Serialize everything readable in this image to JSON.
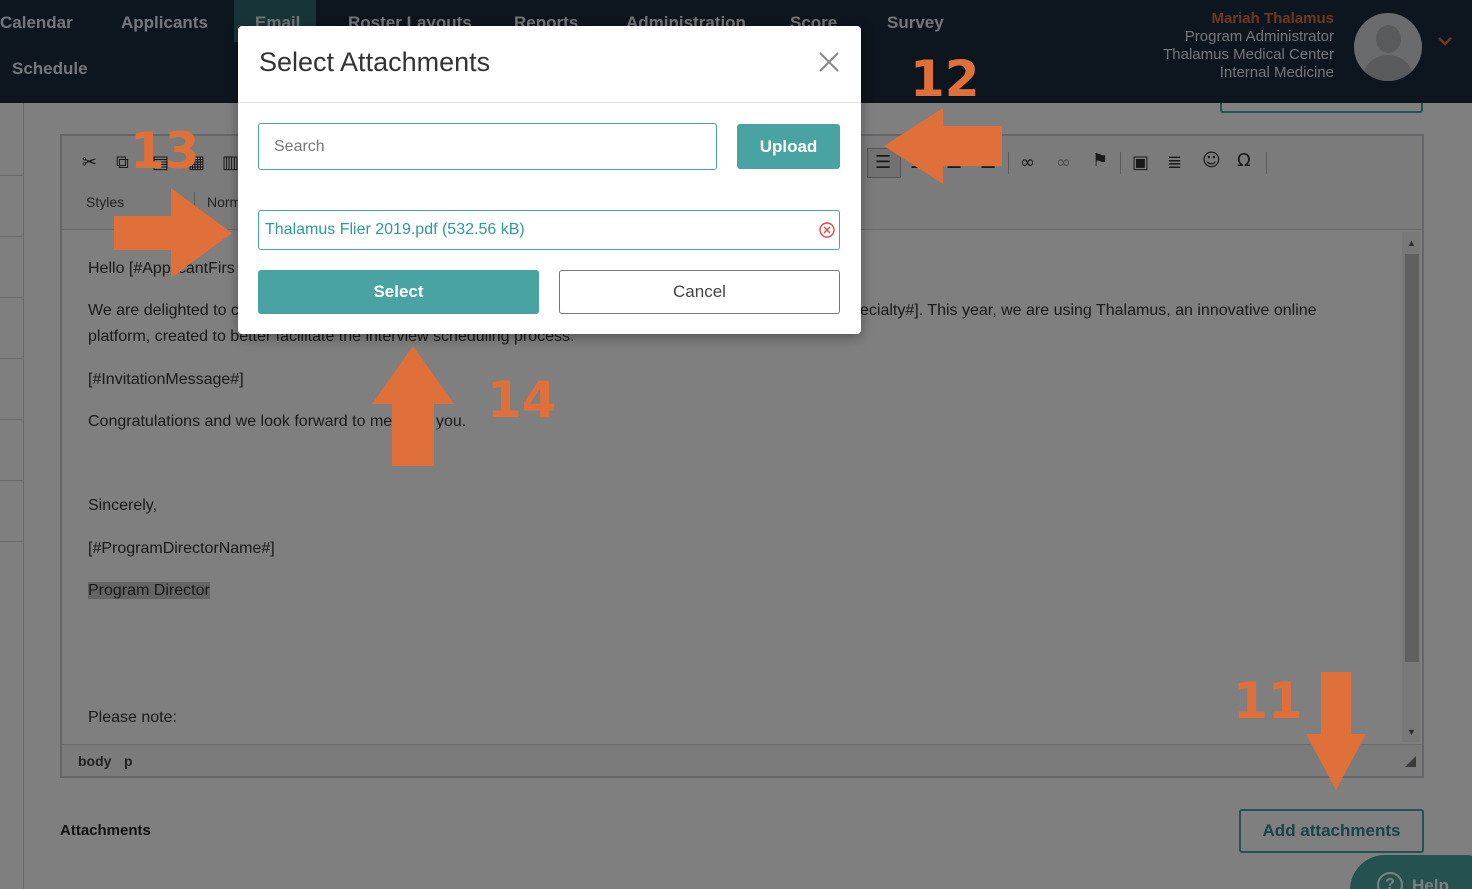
{
  "nav": {
    "items": [
      {
        "label": "Calendar"
      },
      {
        "label": "Applicants"
      },
      {
        "label": "Email"
      },
      {
        "label": "Roster Layouts"
      },
      {
        "label": "Reports"
      },
      {
        "label": "Administration"
      },
      {
        "label": "Score"
      },
      {
        "label": "Survey"
      },
      {
        "label": "Schedule"
      }
    ],
    "active": "Email"
  },
  "user": {
    "name": "Mariah Thalamus",
    "role": "Program Administrator",
    "institution": "Thalamus Medical Center",
    "department": "Internal Medicine",
    "avatar_icon": "user-avatar-icon",
    "menu_icon": "chevron-down-icon"
  },
  "editor": {
    "toolbar": {
      "styles_label": "Styles",
      "format_label": "Norm",
      "icons": [
        "cut-icon",
        "copy-icon",
        "paste-icon",
        "paste-text-icon",
        "paste-word-icon",
        "align-left-icon",
        "align-center-icon",
        "align-right-icon",
        "align-justify-icon",
        "link-icon",
        "unlink-icon",
        "anchor-icon",
        "image-icon",
        "horizontal-line-icon",
        "smiley-icon",
        "special-char-icon"
      ]
    },
    "body": {
      "greeting": "Hello [#ApplicantFirs",
      "line1_left": "We are delighted to c",
      "line1_right": "ecialty#]. This year, we are using Thalamus, an innovative online",
      "line2": "platform, created to better facilitate the interview scheduling process.",
      "invitation": "[#InvitationMessage#]",
      "congrats": "Congratulations and we look forward to me",
      "congrats_end": "you.",
      "closing": "Sincerely,",
      "director_name": "[#ProgramDirectorName#]",
      "director_title": "Program Director",
      "note": "Please note:"
    },
    "status_path": [
      "body",
      "p"
    ]
  },
  "attachments": {
    "label": "Attachments",
    "add_button": "Add attachments"
  },
  "help": {
    "label": "Help"
  },
  "modal": {
    "title": "Select Attachments",
    "search_placeholder": "Search",
    "upload_label": "Upload",
    "files": [
      {
        "name": "Thalamus Flier 2019.pdf (532.56 kB)"
      }
    ],
    "select_label": "Select",
    "cancel_label": "Cancel"
  },
  "annotations": {
    "n11": "11",
    "n12": "12",
    "n13": "13",
    "n14": "14",
    "color": "#e0703a"
  },
  "colors": {
    "nav_bg": "#1a2b3c",
    "accent": "#4aa3a3",
    "user_name": "#e0703a"
  }
}
